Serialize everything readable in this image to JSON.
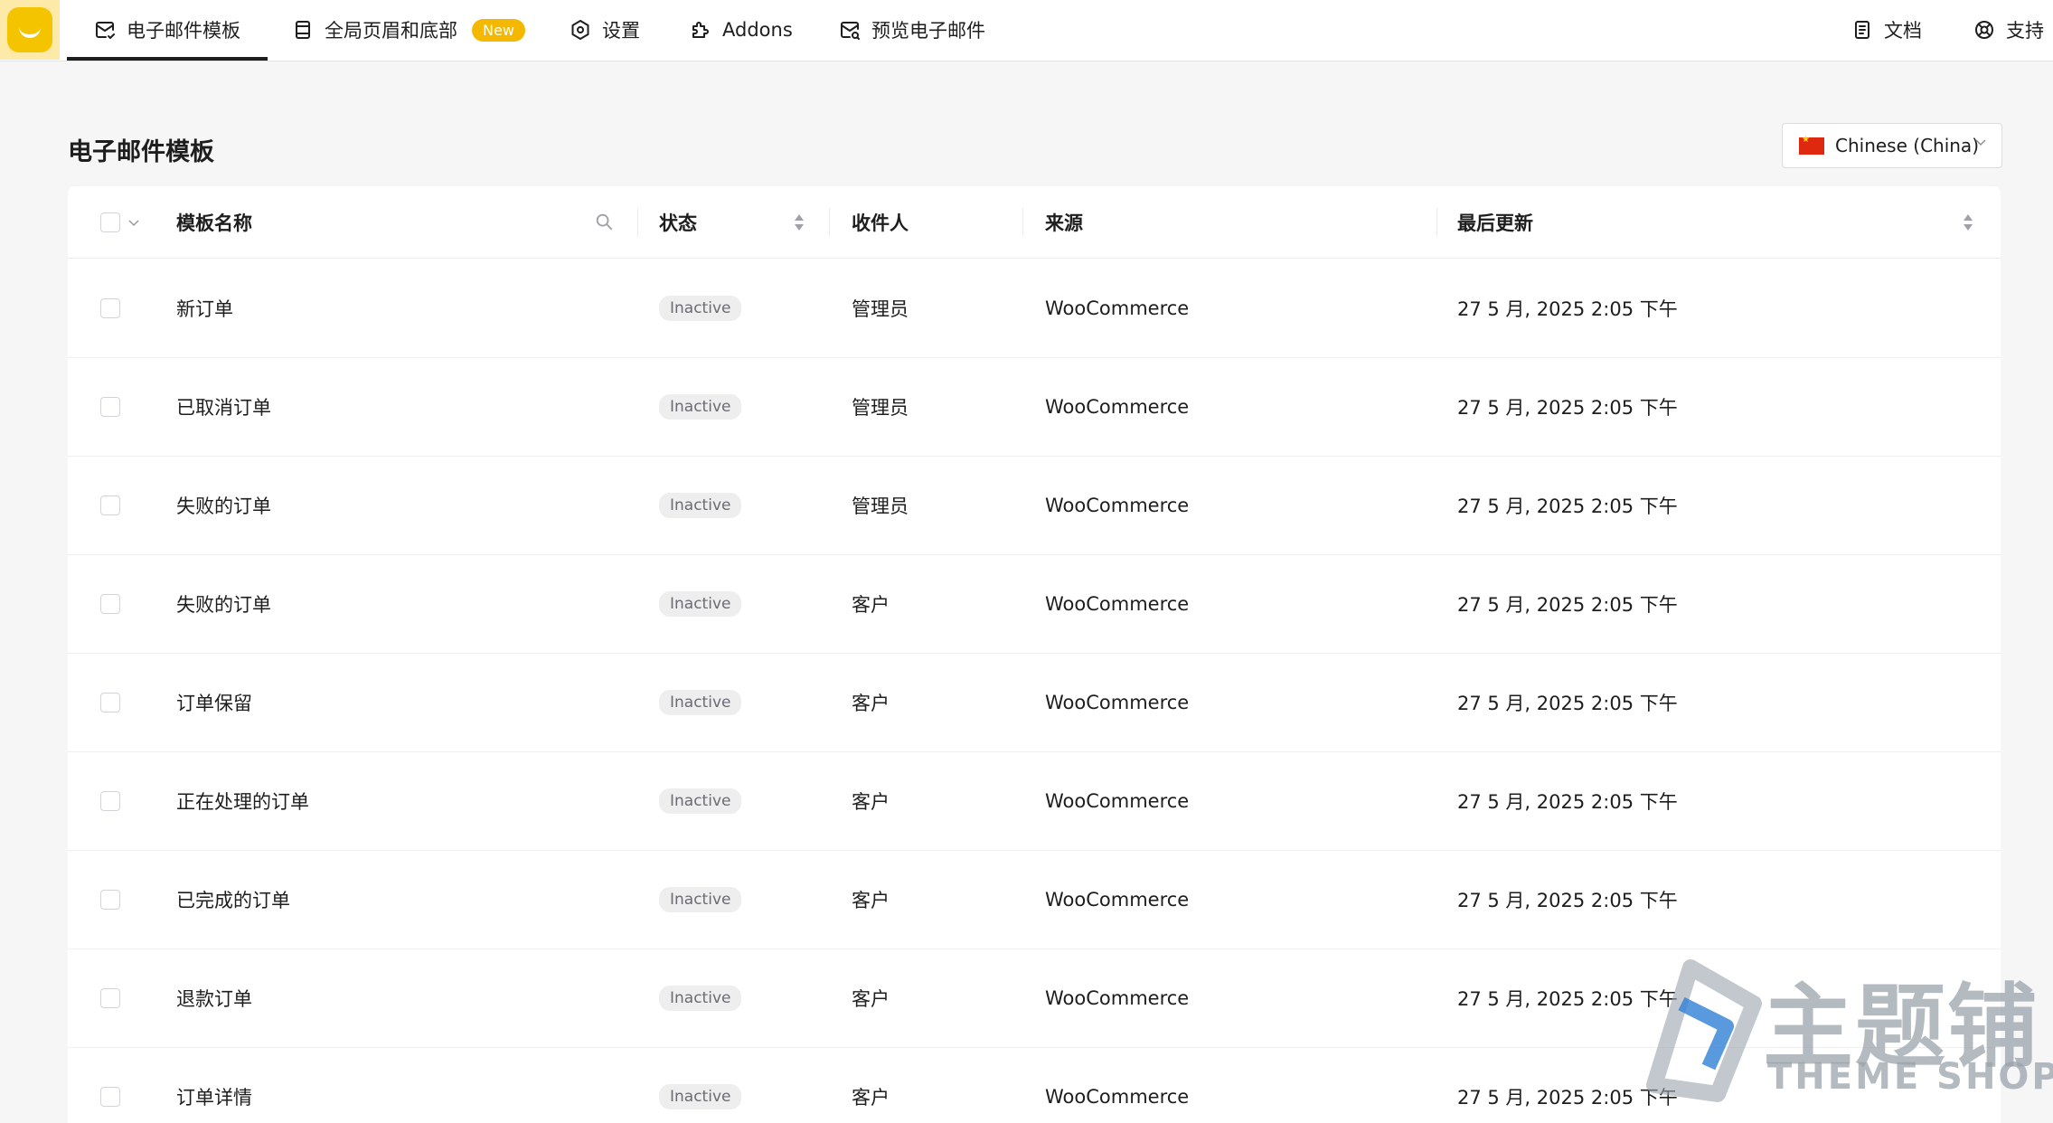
{
  "nav": {
    "tabs": [
      {
        "label": "电子邮件模板",
        "icon": "mail-check-icon"
      },
      {
        "label": "全局页眉和底部",
        "icon": "layout-icon",
        "badge": "New"
      },
      {
        "label": "设置",
        "icon": "settings-hex-icon"
      },
      {
        "label": "Addons",
        "icon": "puzzle-icon"
      },
      {
        "label": "预览电子邮件",
        "icon": "mail-search-icon"
      }
    ],
    "right": [
      {
        "label": "文档",
        "icon": "document-icon"
      },
      {
        "label": "支持",
        "icon": "lifebuoy-icon"
      }
    ]
  },
  "page": {
    "title": "电子邮件模板",
    "language": "Chinese (China)"
  },
  "table": {
    "columns": [
      "模板名称",
      "状态",
      "收件人",
      "来源",
      "最后更新"
    ],
    "rows": [
      {
        "name": "新订单",
        "status": "Inactive",
        "recipient": "管理员",
        "source": "WooCommerce",
        "updated": "27 5 月, 2025 2:05 下午"
      },
      {
        "name": "已取消订单",
        "status": "Inactive",
        "recipient": "管理员",
        "source": "WooCommerce",
        "updated": "27 5 月, 2025 2:05 下午"
      },
      {
        "name": "失败的订单",
        "status": "Inactive",
        "recipient": "管理员",
        "source": "WooCommerce",
        "updated": "27 5 月, 2025 2:05 下午"
      },
      {
        "name": "失败的订单",
        "status": "Inactive",
        "recipient": "客户",
        "source": "WooCommerce",
        "updated": "27 5 月, 2025 2:05 下午"
      },
      {
        "name": "订单保留",
        "status": "Inactive",
        "recipient": "客户",
        "source": "WooCommerce",
        "updated": "27 5 月, 2025 2:05 下午"
      },
      {
        "name": "正在处理的订单",
        "status": "Inactive",
        "recipient": "客户",
        "source": "WooCommerce",
        "updated": "27 5 月, 2025 2:05 下午"
      },
      {
        "name": "已完成的订单",
        "status": "Inactive",
        "recipient": "客户",
        "source": "WooCommerce",
        "updated": "27 5 月, 2025 2:05 下午"
      },
      {
        "name": "退款订单",
        "status": "Inactive",
        "recipient": "客户",
        "source": "WooCommerce",
        "updated": "27 5 月, 2025 2:05 下午"
      },
      {
        "name": "订单详情",
        "status": "Inactive",
        "recipient": "客户",
        "source": "WooCommerce",
        "updated": "27 5 月, 2025 2:05 下午"
      }
    ]
  },
  "watermark": {
    "main": "主题铺",
    "sub": "THEME SHOP"
  },
  "colors": {
    "accent": "#f5c400",
    "badge": "#f5b800",
    "background": "#f6f6f7"
  }
}
